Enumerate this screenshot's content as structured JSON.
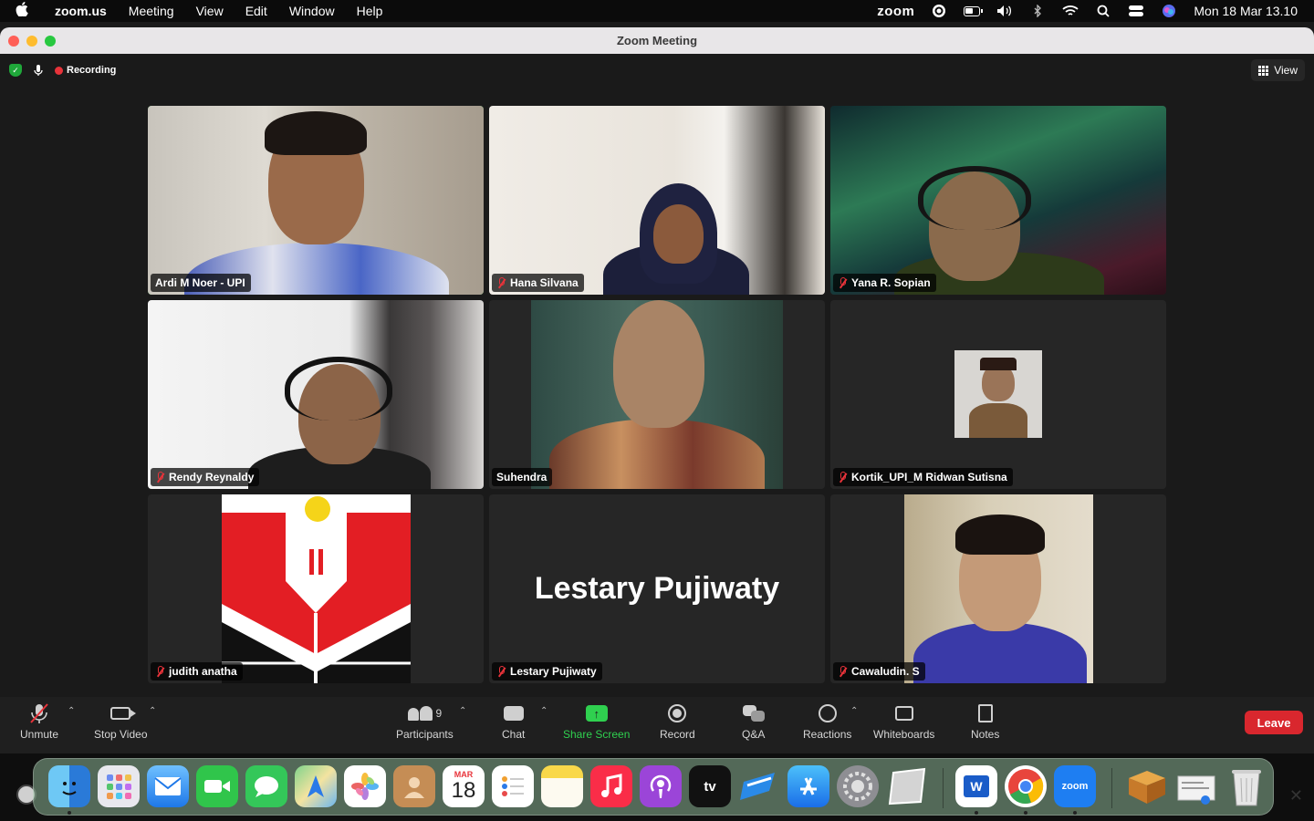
{
  "menubar": {
    "app_name": "zoom.us",
    "menus": [
      "Meeting",
      "View",
      "Edit",
      "Window",
      "Help"
    ],
    "zoom_label": "zoom",
    "datetime": "Mon 18 Mar 13.10"
  },
  "window": {
    "title": "Zoom Meeting",
    "recording_label": "Recording",
    "view_label": "View"
  },
  "participants": [
    {
      "name": "Ardi M Noer - UPI",
      "muted": false,
      "active": true
    },
    {
      "name": "Hana Silvana",
      "muted": true
    },
    {
      "name": "Yana R. Sopian",
      "muted": true
    },
    {
      "name": "Rendy Reynaldy",
      "muted": true
    },
    {
      "name": "Suhendra",
      "muted": false
    },
    {
      "name": "Kortik_UPI_M Ridwan Sutisna",
      "muted": true
    },
    {
      "name": "judith anatha",
      "muted": true
    },
    {
      "name": "Lestary Pujiwaty",
      "muted": true,
      "display_text": "Lestary Pujiwaty"
    },
    {
      "name": "Cawaludin. S",
      "muted": true
    }
  ],
  "toolbar": {
    "unmute": "Unmute",
    "stop_video": "Stop Video",
    "participants": "Participants",
    "participants_count": "9",
    "chat": "Chat",
    "share_screen": "Share Screen",
    "record": "Record",
    "qa": "Q&A",
    "reactions": "Reactions",
    "whiteboards": "Whiteboards",
    "notes": "Notes",
    "leave": "Leave"
  },
  "dock": {
    "calendar_month": "MAR",
    "calendar_day": "18",
    "tv_label": "tv",
    "word_label": "W",
    "zoom_label": "zoom"
  },
  "colors": {
    "active_speaker": "#2fd04f",
    "share_green": "#2fd04f",
    "leave_red": "#d9272e",
    "recording_red": "#e8333a"
  }
}
